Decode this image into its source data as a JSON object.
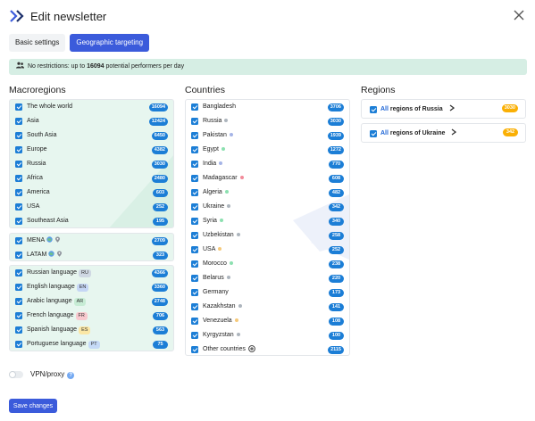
{
  "header": {
    "title": "Edit newsletter"
  },
  "tabs": [
    {
      "label": "Basic settings",
      "active": false
    },
    {
      "label": "Geographic targeting",
      "active": true
    }
  ],
  "info": {
    "prefix": "No restrictions: up to",
    "count": "16094",
    "suffix": "potential performers per day"
  },
  "macroregions": {
    "title": "Macroregions",
    "group1": [
      {
        "label": "The whole world",
        "count": "16094"
      },
      {
        "label": "Asia",
        "count": "12424"
      },
      {
        "label": "South Asia",
        "count": "6450"
      },
      {
        "label": "Europe",
        "count": "4382"
      },
      {
        "label": "Russia",
        "count": "3030"
      },
      {
        "label": "Africa",
        "count": "2480"
      },
      {
        "label": "America",
        "count": "603"
      },
      {
        "label": "USA",
        "count": "252"
      },
      {
        "label": "Southeast Asia",
        "count": "195"
      }
    ],
    "group2": [
      {
        "label": "MENA",
        "count": "2709"
      },
      {
        "label": "LATAM",
        "count": "323"
      }
    ],
    "group3": [
      {
        "label": "Russian language",
        "tag": "RU",
        "tag_color": "#cfd8e3",
        "count": "4366"
      },
      {
        "label": "English language",
        "tag": "EN",
        "tag_color": "#c5d6f5",
        "count": "3360"
      },
      {
        "label": "Arabic language",
        "tag": "AR",
        "tag_color": "#c7ecd5",
        "count": "2748"
      },
      {
        "label": "French language",
        "tag": "FR",
        "tag_color": "#f8c9cf",
        "count": "706"
      },
      {
        "label": "Spanish language",
        "tag": "ES",
        "tag_color": "#fbe7a5",
        "count": "563"
      },
      {
        "label": "Portuguese language",
        "tag": "PT",
        "tag_color": "#c5daf7",
        "count": "75"
      }
    ]
  },
  "countries": {
    "title": "Countries",
    "items": [
      {
        "label": "Bangladesh",
        "dot": "",
        "count": "3706"
      },
      {
        "label": "Russia",
        "dot": "#adb5bd",
        "count": "3030"
      },
      {
        "label": "Pakistan",
        "dot": "#a5b4e6",
        "count": "1939"
      },
      {
        "label": "Egypt",
        "dot": "#8ce0b0",
        "count": "1272"
      },
      {
        "label": "India",
        "dot": "#a5b4e6",
        "count": "770"
      },
      {
        "label": "Madagascar",
        "dot": "#f28b9a",
        "count": "608"
      },
      {
        "label": "Algeria",
        "dot": "#8ce0b0",
        "count": "482"
      },
      {
        "label": "Ukraine",
        "dot": "#adb5bd",
        "count": "342"
      },
      {
        "label": "Syria",
        "dot": "#8ce0b0",
        "count": "340"
      },
      {
        "label": "Uzbekistan",
        "dot": "#adb5bd",
        "count": "258"
      },
      {
        "label": "USA",
        "dot": "#f6c97a",
        "count": "252"
      },
      {
        "label": "Morocco",
        "dot": "#8ce0b0",
        "count": "238"
      },
      {
        "label": "Belarus",
        "dot": "#adb5bd",
        "count": "220"
      },
      {
        "label": "Germany",
        "dot": "",
        "count": "173"
      },
      {
        "label": "Kazakhstan",
        "dot": "#adb5bd",
        "count": "141"
      },
      {
        "label": "Venezuela",
        "dot": "#f6c97a",
        "count": "108"
      },
      {
        "label": "Kyrgyzstan",
        "dot": "#adb5bd",
        "count": "100"
      },
      {
        "label": "Other countries",
        "dot": "",
        "count": "2115"
      }
    ]
  },
  "regions": {
    "title": "Regions",
    "items": [
      {
        "all": "All",
        "label": "regions of Russia",
        "count": "3030"
      },
      {
        "all": "All",
        "label": "regions of Ukraine",
        "count": "342"
      }
    ]
  },
  "vpn": {
    "label": "VPN/proxy",
    "enabled": false
  },
  "save": {
    "label": "Save changes"
  },
  "colors": {
    "primary": "#3b5bdb",
    "badge": "#1c7ed6",
    "badge_region": "#fab005",
    "info_bg": "#d6eee4",
    "tint": "#e7f6ef"
  }
}
